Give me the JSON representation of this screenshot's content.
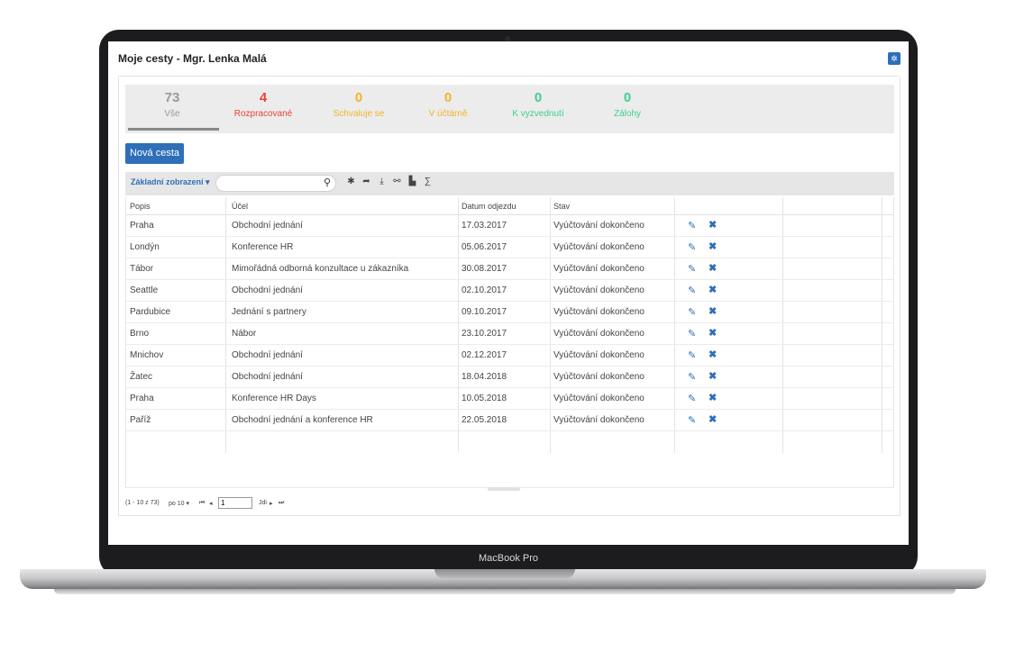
{
  "device": {
    "label": "MacBook Pro"
  },
  "header": {
    "title": "Moje cesty -  Mgr. Lenka Malá",
    "settings_icon": "gear-icon"
  },
  "stats": [
    {
      "count": "73",
      "label": "Vše",
      "color": "#9a9a9a"
    },
    {
      "count": "4",
      "label": "Rozpracované",
      "color": "#e8403a"
    },
    {
      "count": "0",
      "label": "Schvaluje se",
      "color": "#f0b428"
    },
    {
      "count": "0",
      "label": "V účtárně",
      "color": "#f0b428"
    },
    {
      "count": "0",
      "label": "K vyzvednutí",
      "color": "#3fcf8e"
    },
    {
      "count": "0",
      "label": "Zálohy",
      "color": "#3fcf8e"
    }
  ],
  "actions": {
    "new_trip": "Nová cesta"
  },
  "toolbar": {
    "view_label": "Základní zobrazení",
    "search_value": "",
    "icons": [
      "search-icon",
      "gear-icon",
      "share-icon",
      "download-icon",
      "link-icon",
      "print-icon",
      "sum-icon"
    ]
  },
  "grid": {
    "columns": [
      "Popis",
      "Účel",
      "Datum odjezdu",
      "Stav"
    ],
    "rows": [
      {
        "popis": "Praha",
        "ucel": "Obchodní jednání",
        "datum": "17.03.2017",
        "stav": "Vyúčtování dokončeno"
      },
      {
        "popis": "Londýn",
        "ucel": "Konference HR",
        "datum": "05.06.2017",
        "stav": "Vyúčtování dokončeno"
      },
      {
        "popis": "Tábor",
        "ucel": "Mimořádná odborná konzultace u zákazníka",
        "datum": "30.08.2017",
        "stav": "Vyúčtování dokončeno"
      },
      {
        "popis": "Seattle",
        "ucel": "Obchodní jednání",
        "datum": "02.10.2017",
        "stav": "Vyúčtování dokončeno"
      },
      {
        "popis": "Pardubice",
        "ucel": "Jednání s partnery",
        "datum": "09.10.2017",
        "stav": "Vyúčtování dokončeno"
      },
      {
        "popis": "Brno",
        "ucel": "Nábor",
        "datum": "23.10.2017",
        "stav": "Vyúčtování dokončeno"
      },
      {
        "popis": "Mnichov",
        "ucel": "Obchodní jednání",
        "datum": "02.12.2017",
        "stav": "Vyúčtování dokončeno"
      },
      {
        "popis": "Žatec",
        "ucel": "Obchodní jednání",
        "datum": "18.04.2018",
        "stav": "Vyúčtování dokončeno"
      },
      {
        "popis": "Praha",
        "ucel": "Konference HR Days",
        "datum": "10.05.2018",
        "stav": "Vyúčtování dokončeno"
      },
      {
        "popis": "Paříž",
        "ucel": "Obchodní jednání a konference HR",
        "datum": "22.05.2018",
        "stav": "Vyúčtování dokončeno"
      }
    ]
  },
  "pager": {
    "range": "(1 - 10 z 73)",
    "per_page": "po 10",
    "page_value": "1",
    "go_label": "Jdi"
  },
  "colors": {
    "accent": "#2e6fb7"
  }
}
